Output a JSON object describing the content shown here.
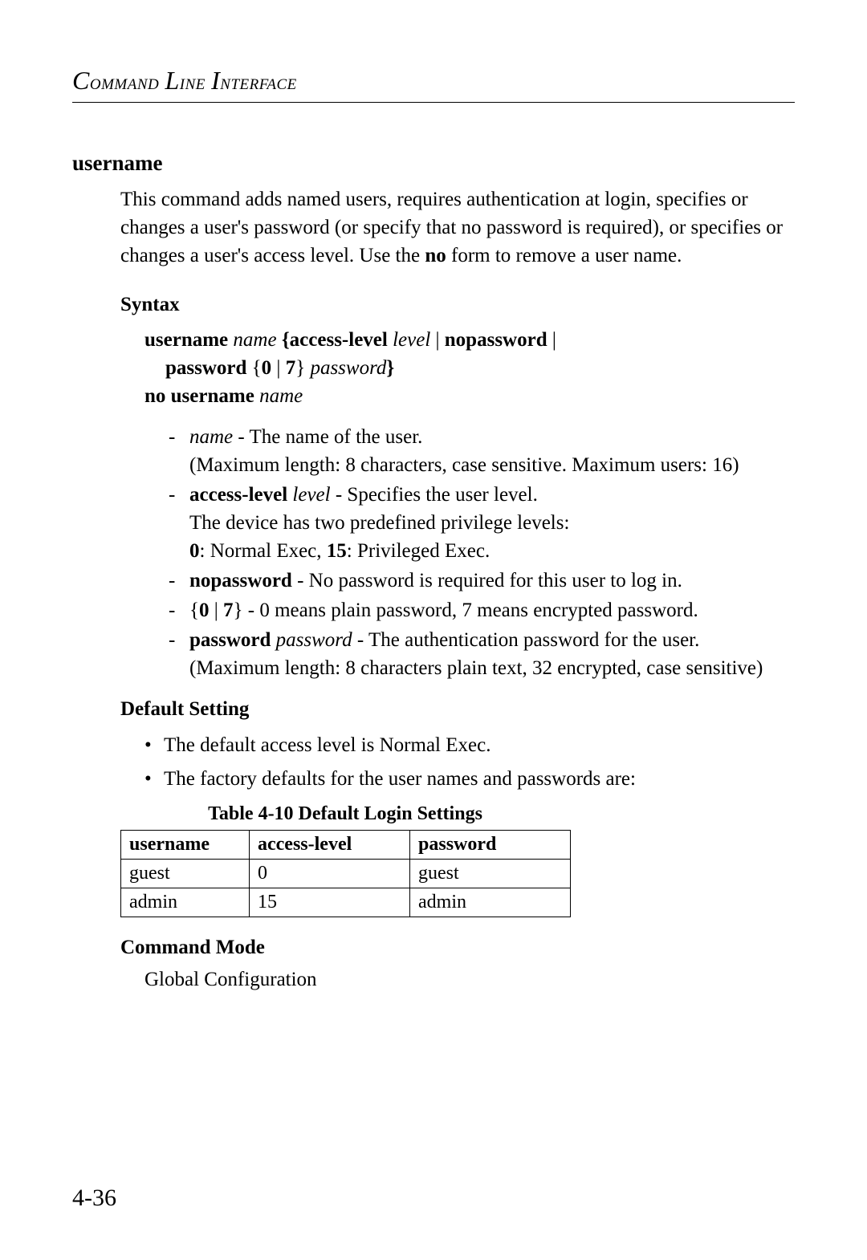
{
  "header": {
    "text": "Command Line Interface"
  },
  "command": {
    "title": "username",
    "description_parts": {
      "p1": "This command adds named users, requires authentication at login, specifies or changes a user's password (or specify that no password is required), or specifies or changes a user's access level. Use the ",
      "p2": "no",
      "p3": " form to remove a user name."
    }
  },
  "syntax": {
    "heading": "Syntax",
    "line1": {
      "s1": "username",
      "s2": " name ",
      "s3": "{",
      "s4": "access-level",
      "s5": " level ",
      "s6": "| ",
      "s7": "nopassword",
      "s8": " |"
    },
    "line2": {
      "s1": "password",
      "s2": " {",
      "s3": "0",
      "s4": " | ",
      "s5": "7",
      "s6": "}",
      "s7": " password",
      "s8": "}"
    },
    "line3": {
      "s1": "no username",
      "s2": " name"
    }
  },
  "params": [
    {
      "dash": "-",
      "parts": {
        "p1": "name",
        "p2": " - The name of the user."
      },
      "cont1": "(Maximum length: 8 characters, case sensitive. Maximum users: 16)"
    },
    {
      "dash": "-",
      "parts": {
        "p1": "access-level",
        "p2": " level",
        "p3": " - Specifies the user level."
      },
      "cont1": "The device has two predefined privilege levels:",
      "cont2": {
        "a": "0",
        "b": ": Normal Exec, ",
        "c": "15",
        "d": ": Privileged Exec."
      }
    },
    {
      "dash": "-",
      "parts": {
        "p1": "nopassword",
        "p2": " - No password is required for this user to log in."
      }
    },
    {
      "dash": "-",
      "parts": {
        "p1": " {",
        "p2": "0",
        "p3": " | ",
        "p4": "7",
        "p5": "}",
        "p6": " - 0 means plain password, 7 means encrypted password."
      }
    },
    {
      "dash": "-",
      "parts": {
        "p1": "password",
        "p2": " password",
        "p3": " - The authentication password for the user."
      },
      "cont1": "(Maximum length: 8 characters plain text, 32 encrypted, case sensitive)"
    }
  ],
  "default_setting": {
    "heading": "Default Setting",
    "bullets": [
      "The default access level is Normal Exec.",
      "The factory defaults for the user names and passwords are:"
    ]
  },
  "table": {
    "caption": "Table 4-10  Default Login Settings",
    "headers": [
      "username",
      "access-level",
      "password"
    ],
    "rows": [
      [
        "guest",
        "0",
        "guest"
      ],
      [
        "admin",
        "15",
        "admin"
      ]
    ]
  },
  "command_mode": {
    "heading": "Command Mode",
    "text": "Global Configuration"
  },
  "page_number": "4-36",
  "chart_data": {
    "type": "table",
    "title": "Table 4-10  Default Login Settings",
    "columns": [
      "username",
      "access-level",
      "password"
    ],
    "rows": [
      {
        "username": "guest",
        "access-level": 0,
        "password": "guest"
      },
      {
        "username": "admin",
        "access-level": 15,
        "password": "admin"
      }
    ]
  }
}
